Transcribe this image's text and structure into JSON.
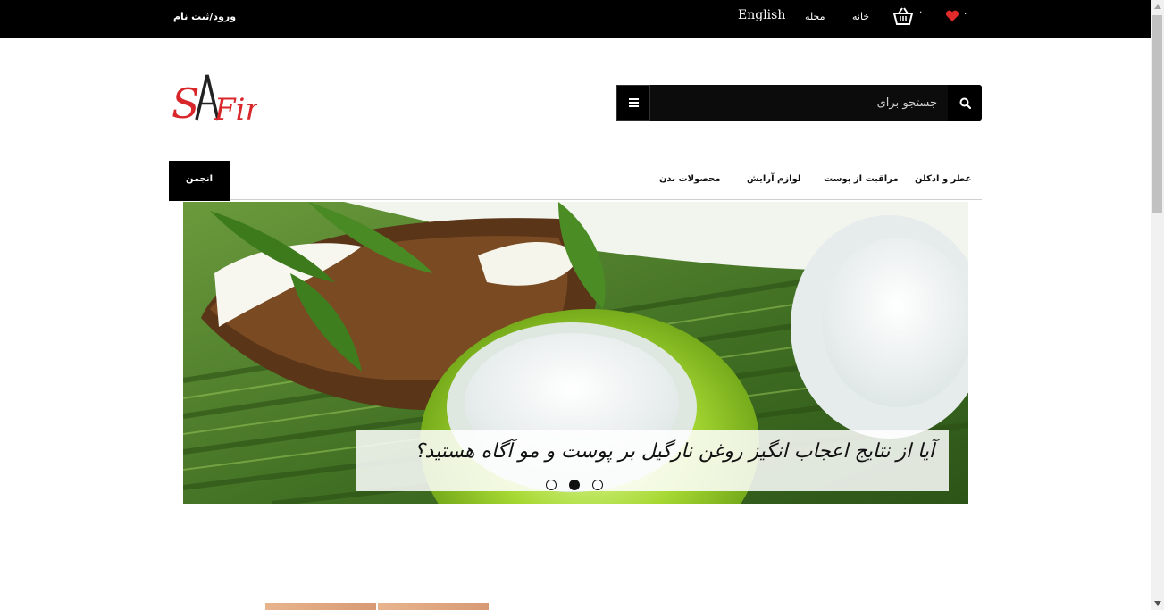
{
  "topbar": {
    "login_label": "ورود/ثبت نام",
    "english_label": "English",
    "magazine_label": "مجله",
    "home_label": "خانه",
    "cart_count": "۰",
    "wishlist_count": "۰"
  },
  "header": {
    "logo_text": "SAFir"
  },
  "search": {
    "placeholder": "جستجو برای"
  },
  "nav": {
    "forum_label": "انجمن",
    "items": [
      {
        "label": "عطر و ادکلن"
      },
      {
        "label": "مراقبت از پوست"
      },
      {
        "label": "لوازم آرایش"
      },
      {
        "label": "محصولات بدن"
      }
    ]
  },
  "slider": {
    "caption": "آیا از نتایج اعجاب انگیز روغن نارگیل بر پوست و مو آگاه هستید؟",
    "slide_count": 3,
    "active_index": 1
  },
  "colors": {
    "topbar_bg": "#000000",
    "accent_red": "#e12b2b"
  }
}
